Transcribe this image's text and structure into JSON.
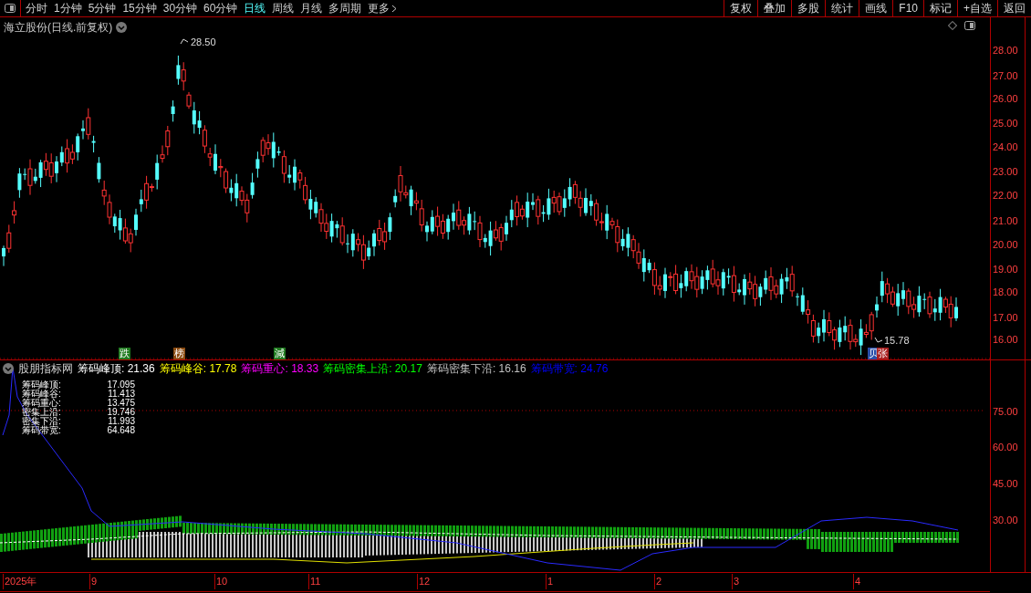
{
  "toolbar": {
    "tabs": [
      {
        "label": "分时",
        "selected": false
      },
      {
        "label": "1分钟",
        "selected": false
      },
      {
        "label": "5分钟",
        "selected": false
      },
      {
        "label": "15分钟",
        "selected": false
      },
      {
        "label": "30分钟",
        "selected": false
      },
      {
        "label": "60分钟",
        "selected": false
      },
      {
        "label": "日线",
        "selected": true
      },
      {
        "label": "周线",
        "selected": false
      },
      {
        "label": "月线",
        "selected": false
      },
      {
        "label": "多周期",
        "selected": false
      },
      {
        "label": "更多",
        "selected": false
      }
    ],
    "buttons": [
      "复权",
      "叠加",
      "多股",
      "统计",
      "画线",
      "F10",
      "标记",
      "+自选",
      "返回"
    ]
  },
  "chart": {
    "title": "海立股份(日线.前复权)",
    "high_label": "28.50",
    "low_label": "15.78",
    "price_axis": [
      "28.00",
      "27.00",
      "26.00",
      "25.00",
      "24.00",
      "23.00",
      "22.00",
      "21.00",
      "20.00",
      "19.00",
      "18.00",
      "17.00",
      "16.00"
    ],
    "markers": [
      {
        "text": "跌",
        "color": "#1f7a1f"
      },
      {
        "text": "榜",
        "color": "#8a4a10"
      },
      {
        "text": "減",
        "color": "#1f7a1f"
      },
      {
        "text": "贝",
        "color": "#2a4fa8"
      },
      {
        "text": "张",
        "color": "#a81f1f"
      }
    ]
  },
  "indicator": {
    "name": "股朋指标网",
    "readouts": [
      {
        "label": "筹码峰顶:",
        "value": "21.36",
        "color": "#ffffff"
      },
      {
        "label": "筹码峰谷:",
        "value": "17.78",
        "color": "#ffff00"
      },
      {
        "label": "筹码重心:",
        "value": "18.33",
        "color": "#ff00ff"
      },
      {
        "label": "筹码密集上沿:",
        "value": "20.17",
        "color": "#00ff00"
      },
      {
        "label": "筹码密集下沿:",
        "value": "16.16",
        "color": "#c0c0c0"
      },
      {
        "label": "筹码带宽:",
        "value": "24.76",
        "color": "#0000ff"
      }
    ],
    "table": [
      {
        "label": "筹码峰顶:",
        "value": "17.095"
      },
      {
        "label": "筹码峰谷:",
        "value": "11.413"
      },
      {
        "label": "筹码重心:",
        "value": "13.475"
      },
      {
        "label": "密集上沿:",
        "value": "19.746"
      },
      {
        "label": "密集下沿:",
        "value": "11.993"
      },
      {
        "label": "筹码带宽:",
        "value": "64.648"
      }
    ],
    "axis": [
      "75.00",
      "60.00",
      "45.00",
      "30.00"
    ]
  },
  "date_axis": [
    "2025年",
    "9",
    "10",
    "11",
    "12",
    "1",
    "2",
    "3",
    "4"
  ]
}
